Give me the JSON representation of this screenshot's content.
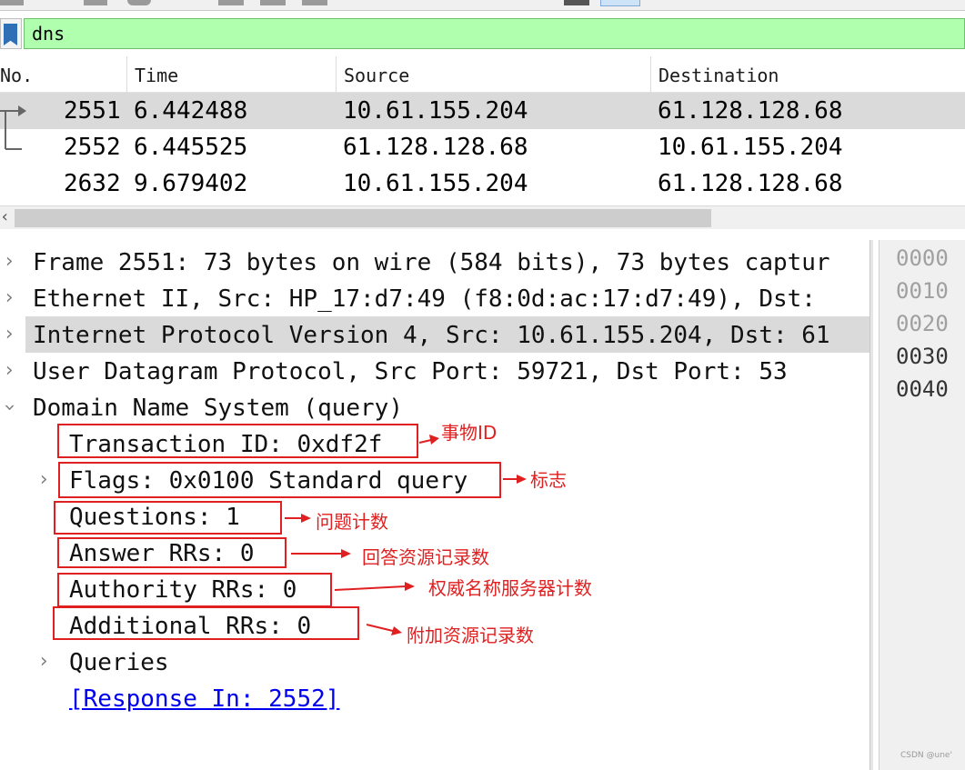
{
  "filter": {
    "value": "dns"
  },
  "packet_list": {
    "columns": [
      "No.",
      "Time",
      "Source",
      "Destination"
    ],
    "rows": [
      {
        "no": "2551",
        "time": "6.442488",
        "source": "10.61.155.204",
        "destination": "61.128.128.68",
        "selected": true
      },
      {
        "no": "2552",
        "time": "6.445525",
        "source": "61.128.128.68",
        "destination": "10.61.155.204",
        "selected": false
      },
      {
        "no": "2632",
        "time": "9.679402",
        "source": "10.61.155.204",
        "destination": "61.128.128.68",
        "selected": false
      }
    ],
    "scroll_left_glyph": "‹"
  },
  "detail": {
    "frame": "Frame 2551: 73 bytes on wire (584 bits), 73 bytes captur",
    "ethernet": "Ethernet II, Src: HP_17:d7:49 (f8:0d:ac:17:d7:49), Dst:",
    "ip": "Internet Protocol Version 4, Src: 10.61.155.204, Dst: 61",
    "udp": "User Datagram Protocol, Src Port: 59721, Dst Port: 53",
    "dns": "Domain Name System (query)",
    "transaction_id": "Transaction ID: 0xdf2f",
    "flags": "Flags: 0x0100 Standard query",
    "questions": "Questions: 1",
    "answer_rrs": "Answer RRs: 0",
    "authority_rrs": "Authority RRs: 0",
    "additional_rrs": "Additional RRs: 0",
    "queries": "Queries",
    "response_in": "[Response In: 2552]"
  },
  "bytes": {
    "offsets": [
      "0000",
      "0010",
      "0020",
      "0030",
      "0040"
    ]
  },
  "annotations": {
    "transaction_id": "事物ID",
    "flags": "标志",
    "questions": "问题计数",
    "answer_rrs": "回答资源记录数",
    "authority_rrs": "权威名称服务器计数",
    "additional_rrs": "附加资源记录数",
    "color": "#e02020"
  },
  "watermark": "CSDN @une'",
  "colors": {
    "filter_bg": "#afffaf",
    "selection_bg": "#dadada",
    "link": "#0000ee"
  }
}
